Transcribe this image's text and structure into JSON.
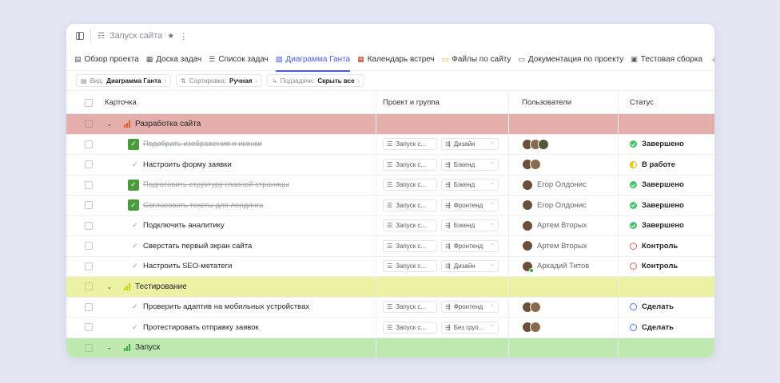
{
  "topbar": {
    "project_title": "Запуск сайта"
  },
  "tabs": [
    {
      "label": "Обзор проекта",
      "icon": "document-icon"
    },
    {
      "label": "Доска задач",
      "icon": "board-icon"
    },
    {
      "label": "Список задач",
      "icon": "list-icon"
    },
    {
      "label": "Диаграмма Ганта",
      "icon": "gantt-icon",
      "active": true
    },
    {
      "label": "Календарь встреч",
      "icon": "calendar-icon"
    },
    {
      "label": "Файлы по сайту",
      "icon": "folder-icon"
    },
    {
      "label": "Документация по проекту",
      "icon": "chat-icon"
    },
    {
      "label": "Тестовая сборка",
      "icon": "build-icon"
    }
  ],
  "filters": [
    {
      "label": "Вид:",
      "value": "Диаграмма Ганта"
    },
    {
      "label": "Сортировка:",
      "value": "Ручная"
    },
    {
      "label": "Подзадачи:",
      "value": "Скрыть все"
    }
  ],
  "columns": {
    "card": "Карточка",
    "project": "Проект и группа",
    "users": "Пользователи",
    "status": "Статус"
  },
  "colors": {
    "group_red": "#e4aeab",
    "group_yellow": "#ebf2a4",
    "group_green": "#bfe9b0",
    "accent": "#4a5bd8",
    "done_check": "#4b9b3d"
  },
  "groups": [
    {
      "title": "Разработка сайта",
      "color": "#e4aeab",
      "icon_color": "#e05a2a",
      "tasks": [
        {
          "title": "Подобрать изображения и иконки",
          "done": true,
          "project": "Запуск с...",
          "group": "Дизайн",
          "avatars": 3,
          "user": "",
          "status": "Завершено",
          "status_type": "done"
        },
        {
          "title": "Настроить форму заявки",
          "done": false,
          "project": "Запуск с...",
          "group": "Бэкенд",
          "avatars": 2,
          "user": "",
          "status": "В работе",
          "status_type": "work"
        },
        {
          "title": "Подготовить структуру главной страницы",
          "done": true,
          "project": "Запуск с...",
          "group": "Бэкенд",
          "avatars": 1,
          "user": "Егор Олдонис",
          "status": "Завершено",
          "status_type": "done"
        },
        {
          "title": "Согласовать тексты для лендинга",
          "done": true,
          "project": "Запуск с...",
          "group": "Фронтенд",
          "avatars": 1,
          "user": "Егор Олдонис",
          "status": "Завершено",
          "status_type": "done"
        },
        {
          "title": "Подключить аналитику",
          "done": false,
          "project": "Запуск с...",
          "group": "Бэкенд",
          "avatars": 1,
          "user": "Артем Вторых",
          "status": "Завершено",
          "status_type": "done"
        },
        {
          "title": "Сверстать первый экран сайта",
          "done": false,
          "project": "Запуск с...",
          "group": "Фронтенд",
          "avatars": 1,
          "user": "Артем Вторых",
          "status": "Контроль",
          "status_type": "ctrl"
        },
        {
          "title": "Настроить SEO-метатеги",
          "done": false,
          "project": "Запуск с...",
          "group": "Дизайн",
          "avatars": 1,
          "user": "Аркадий Титов",
          "online": true,
          "status": "Контроль",
          "status_type": "ctrl"
        }
      ]
    },
    {
      "title": "Тестирование",
      "color": "#ebf2a4",
      "icon_color": "#c8d400",
      "tasks": [
        {
          "title": "Проверить адаптив на мобильных устройствах",
          "done": false,
          "project": "Запуск с...",
          "group": "Фронтенд",
          "avatars": 2,
          "user": "",
          "status": "Сделать",
          "status_type": "todo"
        },
        {
          "title": "Протестировать отправку заявок",
          "done": false,
          "project": "Запуск с...",
          "group": "Без груп...",
          "avatars": 2,
          "user": "",
          "status": "Сделать",
          "status_type": "todo"
        }
      ]
    },
    {
      "title": "Запуск",
      "color": "#bfe9b0",
      "icon_color": "#3aaa3a",
      "tasks": []
    }
  ]
}
